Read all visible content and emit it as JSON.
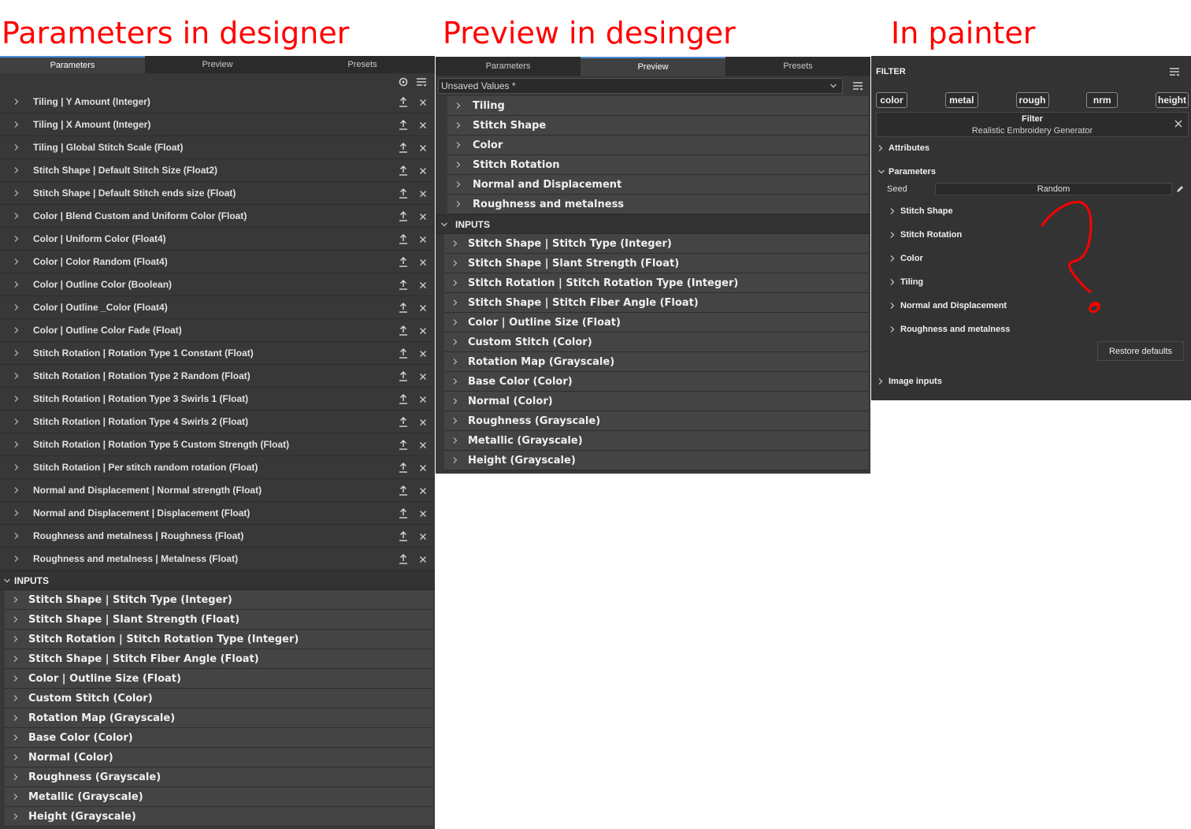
{
  "headings": {
    "designer_params": "Parameters in designer",
    "designer_preview": "Preview in desinger",
    "painter": "In painter"
  },
  "designer_params_panel": {
    "tabs": [
      {
        "label": "Parameters",
        "active": true
      },
      {
        "label": "Preview",
        "active": false
      },
      {
        "label": "Presets",
        "active": false
      }
    ],
    "toolbar_icons": [
      "gear-plus-icon",
      "list-menu-icon"
    ],
    "parameters": [
      "Tiling | Y Amount (Integer)",
      "Tiling | X Amount (Integer)",
      "Tiling | Global Stitch Scale (Float)",
      "Stitch Shape | Default Stitch Size (Float2)",
      "Stitch Shape | Default Stitch ends size (Float)",
      "Color | Blend Custom and Uniform Color (Float)",
      "Color | Uniform Color (Float4)",
      "Color | Color Random (Float4)",
      "Color | Outline Color (Boolean)",
      "Color | Outline _Color (Float4)",
      "Color | Outline Color Fade (Float)",
      "Stitch Rotation | Rotation Type 1 Constant (Float)",
      "Stitch Rotation | Rotation Type 2 Random (Float)",
      "Stitch Rotation | Rotation Type 3 Swirls 1 (Float)",
      "Stitch Rotation | Rotation Type 4 Swirls 2 (Float)",
      "Stitch Rotation | Rotation Type 5 Custom Strength (Float)",
      "Stitch Rotation | Per stitch random rotation (Float)",
      "Normal and Displacement | Normal strength (Float)",
      "Normal and Displacement | Displacement (Float)",
      "Roughness and metalness | Roughness (Float)",
      "Roughness and metalness | Metalness (Float)"
    ],
    "inputs_header": "INPUTS",
    "inputs": [
      "Stitch Shape | Stitch Type (Integer)",
      "Stitch Shape | Slant Strength (Float)",
      "Stitch Rotation | Stitch Rotation Type (Integer)",
      "Stitch Shape | Stitch Fiber Angle (Float)",
      "Color | Outline Size (Float)",
      "Custom Stitch (Color)",
      "Rotation Map (Grayscale)",
      "Base Color (Color)",
      "Normal (Color)",
      "Roughness (Grayscale)",
      "Metallic (Grayscale)",
      "Height (Grayscale)"
    ]
  },
  "designer_preview_panel": {
    "tabs": [
      {
        "label": "Parameters",
        "active": false
      },
      {
        "label": "Preview",
        "active": true
      },
      {
        "label": "Presets",
        "active": false
      }
    ],
    "preset_select": "Unsaved Values *",
    "groups": [
      "Tiling",
      "Stitch Shape",
      "Color",
      "Stitch Rotation",
      "Normal and Displacement",
      "Roughness and metalness"
    ],
    "inputs_header": "INPUTS",
    "inputs": [
      "Stitch Shape | Stitch Type (Integer)",
      "Stitch Shape | Slant Strength (Float)",
      "Stitch Rotation | Stitch Rotation Type (Integer)",
      "Stitch Shape | Stitch Fiber Angle (Float)",
      "Color | Outline Size (Float)",
      "Custom Stitch (Color)",
      "Rotation Map (Grayscale)",
      "Base Color (Color)",
      "Normal (Color)",
      "Roughness (Grayscale)",
      "Metallic (Grayscale)",
      "Height (Grayscale)"
    ]
  },
  "painter_panel": {
    "title": "FILTER",
    "channels": [
      "color",
      "metal",
      "rough",
      "nrm",
      "height"
    ],
    "filter_box": {
      "title": "Filter",
      "name": "Realistic Embroidery Generator"
    },
    "attributes_label": "Attributes",
    "parameters_label": "Parameters",
    "seed": {
      "label": "Seed",
      "value": "Random"
    },
    "groups": [
      "Stitch Shape",
      "Stitch Rotation",
      "Color",
      "Tiling",
      "Normal and Displacement",
      "Roughness and metalness"
    ],
    "restore_button": "Restore defaults",
    "image_inputs_label": "Image inputs"
  },
  "colors": {
    "annotation": "#ff0000",
    "active_tab_accent": "#4a8fd6",
    "panel_bg": "#383838",
    "row_bg": "#444444"
  }
}
